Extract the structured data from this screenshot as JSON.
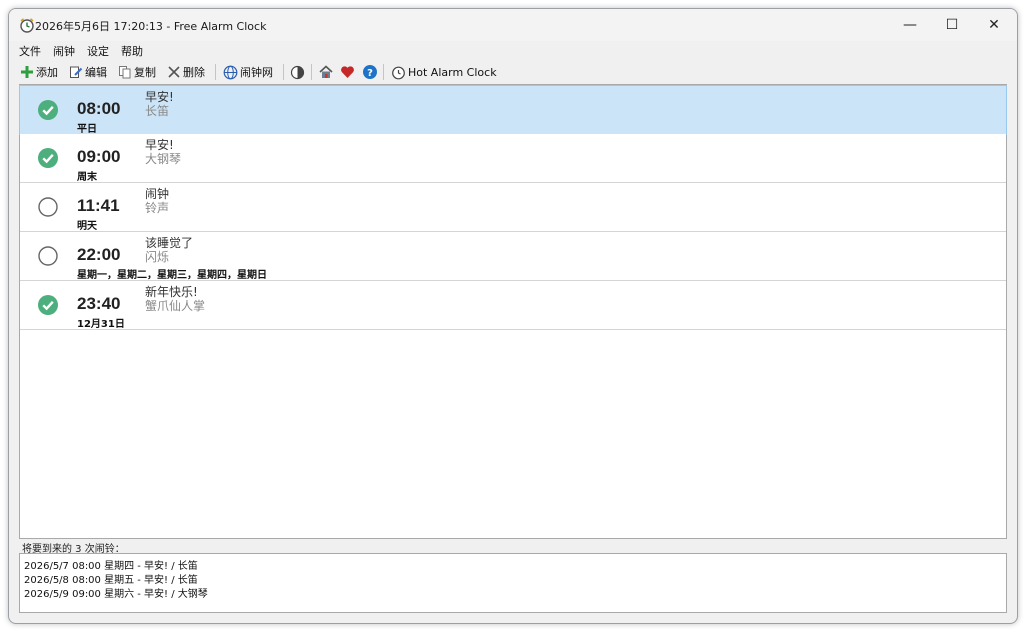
{
  "window": {
    "title": "2026年5月6日 17:20:13 - Free Alarm Clock",
    "controls": {
      "minimize": "—",
      "maximize": "☐",
      "close": "✕"
    }
  },
  "menu": [
    "文件",
    "闹钟",
    "设定",
    "帮助"
  ],
  "toolbar": {
    "add_label": "添加",
    "edit_label": "编辑",
    "copy_label": "复制",
    "delete_label": "删除",
    "alarm_net_label": "闹钟网",
    "hot_alarm_label": "Hot Alarm Clock"
  },
  "alarms": [
    {
      "enabled": true,
      "time": "08:00",
      "days": "平日",
      "message": "早安!",
      "sound": "长笛",
      "selected": true
    },
    {
      "enabled": true,
      "time": "09:00",
      "days": "周末",
      "message": "早安!",
      "sound": "大钢琴",
      "selected": false
    },
    {
      "enabled": false,
      "time": "11:41",
      "days": "明天",
      "message": "闹钟",
      "sound": "铃声",
      "selected": false
    },
    {
      "enabled": false,
      "time": "22:00",
      "days": "星期一，星期二，星期三，星期四，星期日",
      "message": "该睡觉了",
      "sound": "闪烁",
      "selected": false
    },
    {
      "enabled": true,
      "time": "23:40",
      "days": "12月31日",
      "message": "新年快乐!",
      "sound": "蟹爪仙人掌",
      "selected": false
    }
  ],
  "upcoming": {
    "label": "将要到来的 3 次闹铃：",
    "items": [
      "2026/5/7 08:00 星期四 - 早安! / 长笛",
      "2026/5/8 08:00 星期五 - 早安! / 长笛",
      "2026/5/9 09:00 星期六 - 早安! / 大钢琴"
    ]
  },
  "colors": {
    "check_green": "#4caf7d",
    "selected_row": "#cce4f7",
    "help_blue": "#1e73c8",
    "heart_red": "#c62828"
  }
}
